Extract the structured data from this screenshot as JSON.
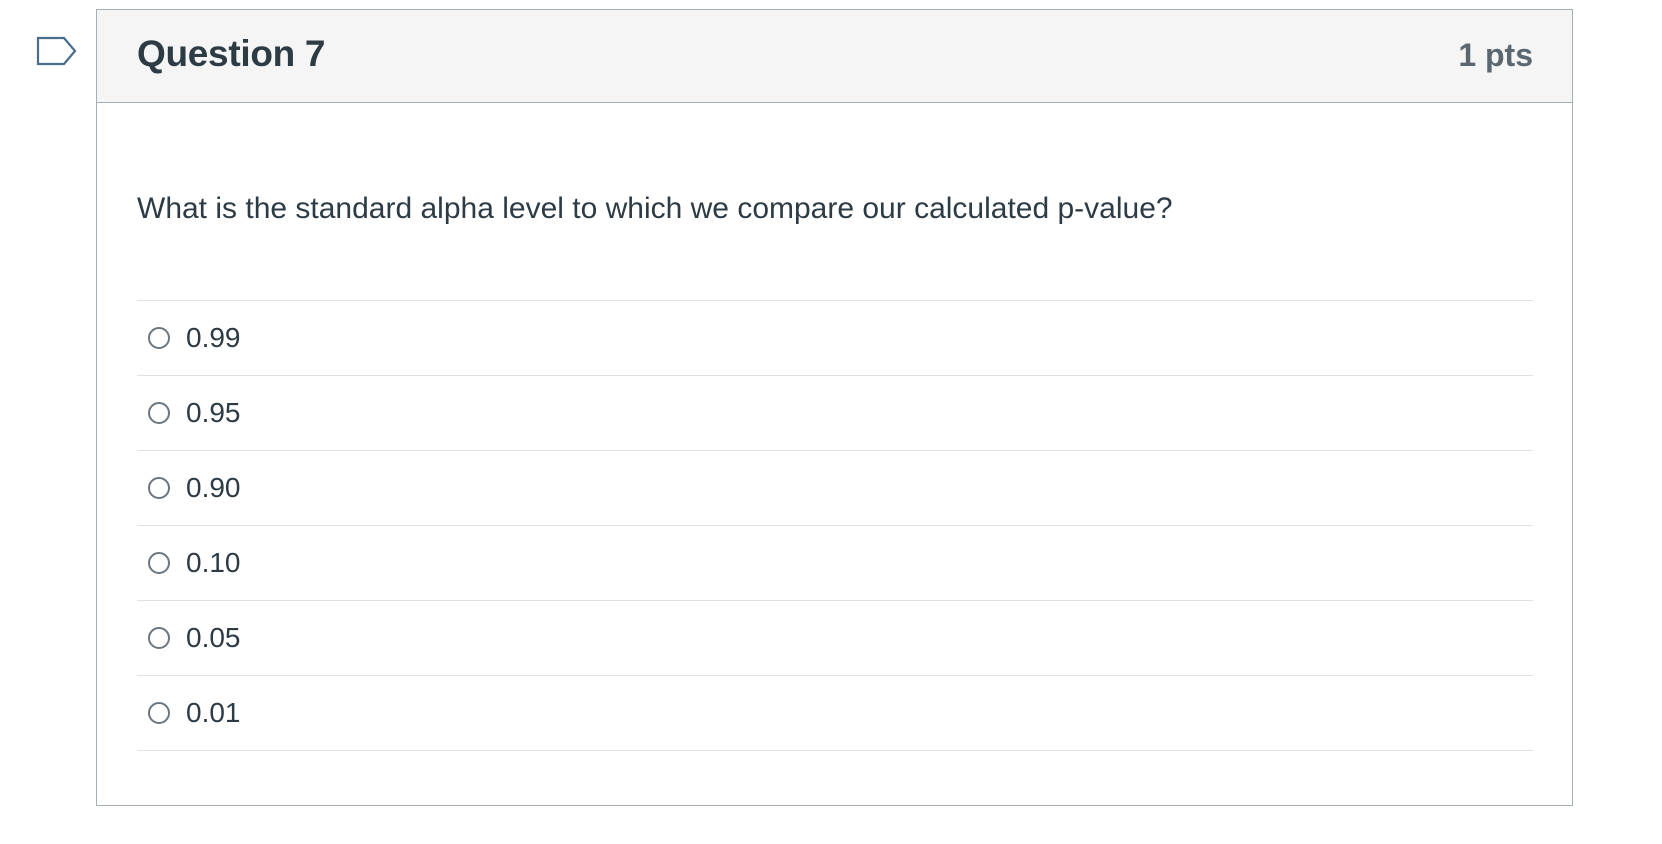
{
  "question": {
    "title": "Question 7",
    "points": "1 pts",
    "text": "What is the standard alpha level to which we compare our calculated p-value?",
    "answers": [
      "0.99",
      "0.95",
      "0.90",
      "0.10",
      "0.05",
      "0.01"
    ],
    "selected": null
  },
  "icons": {
    "flag": "flag-question-icon"
  },
  "colors": {
    "header_bg": "#f5f5f5",
    "border": "#a5afb5",
    "text": "#2d3b45",
    "points_text": "#5a6770",
    "flag_stroke": "#4a6d8c"
  }
}
